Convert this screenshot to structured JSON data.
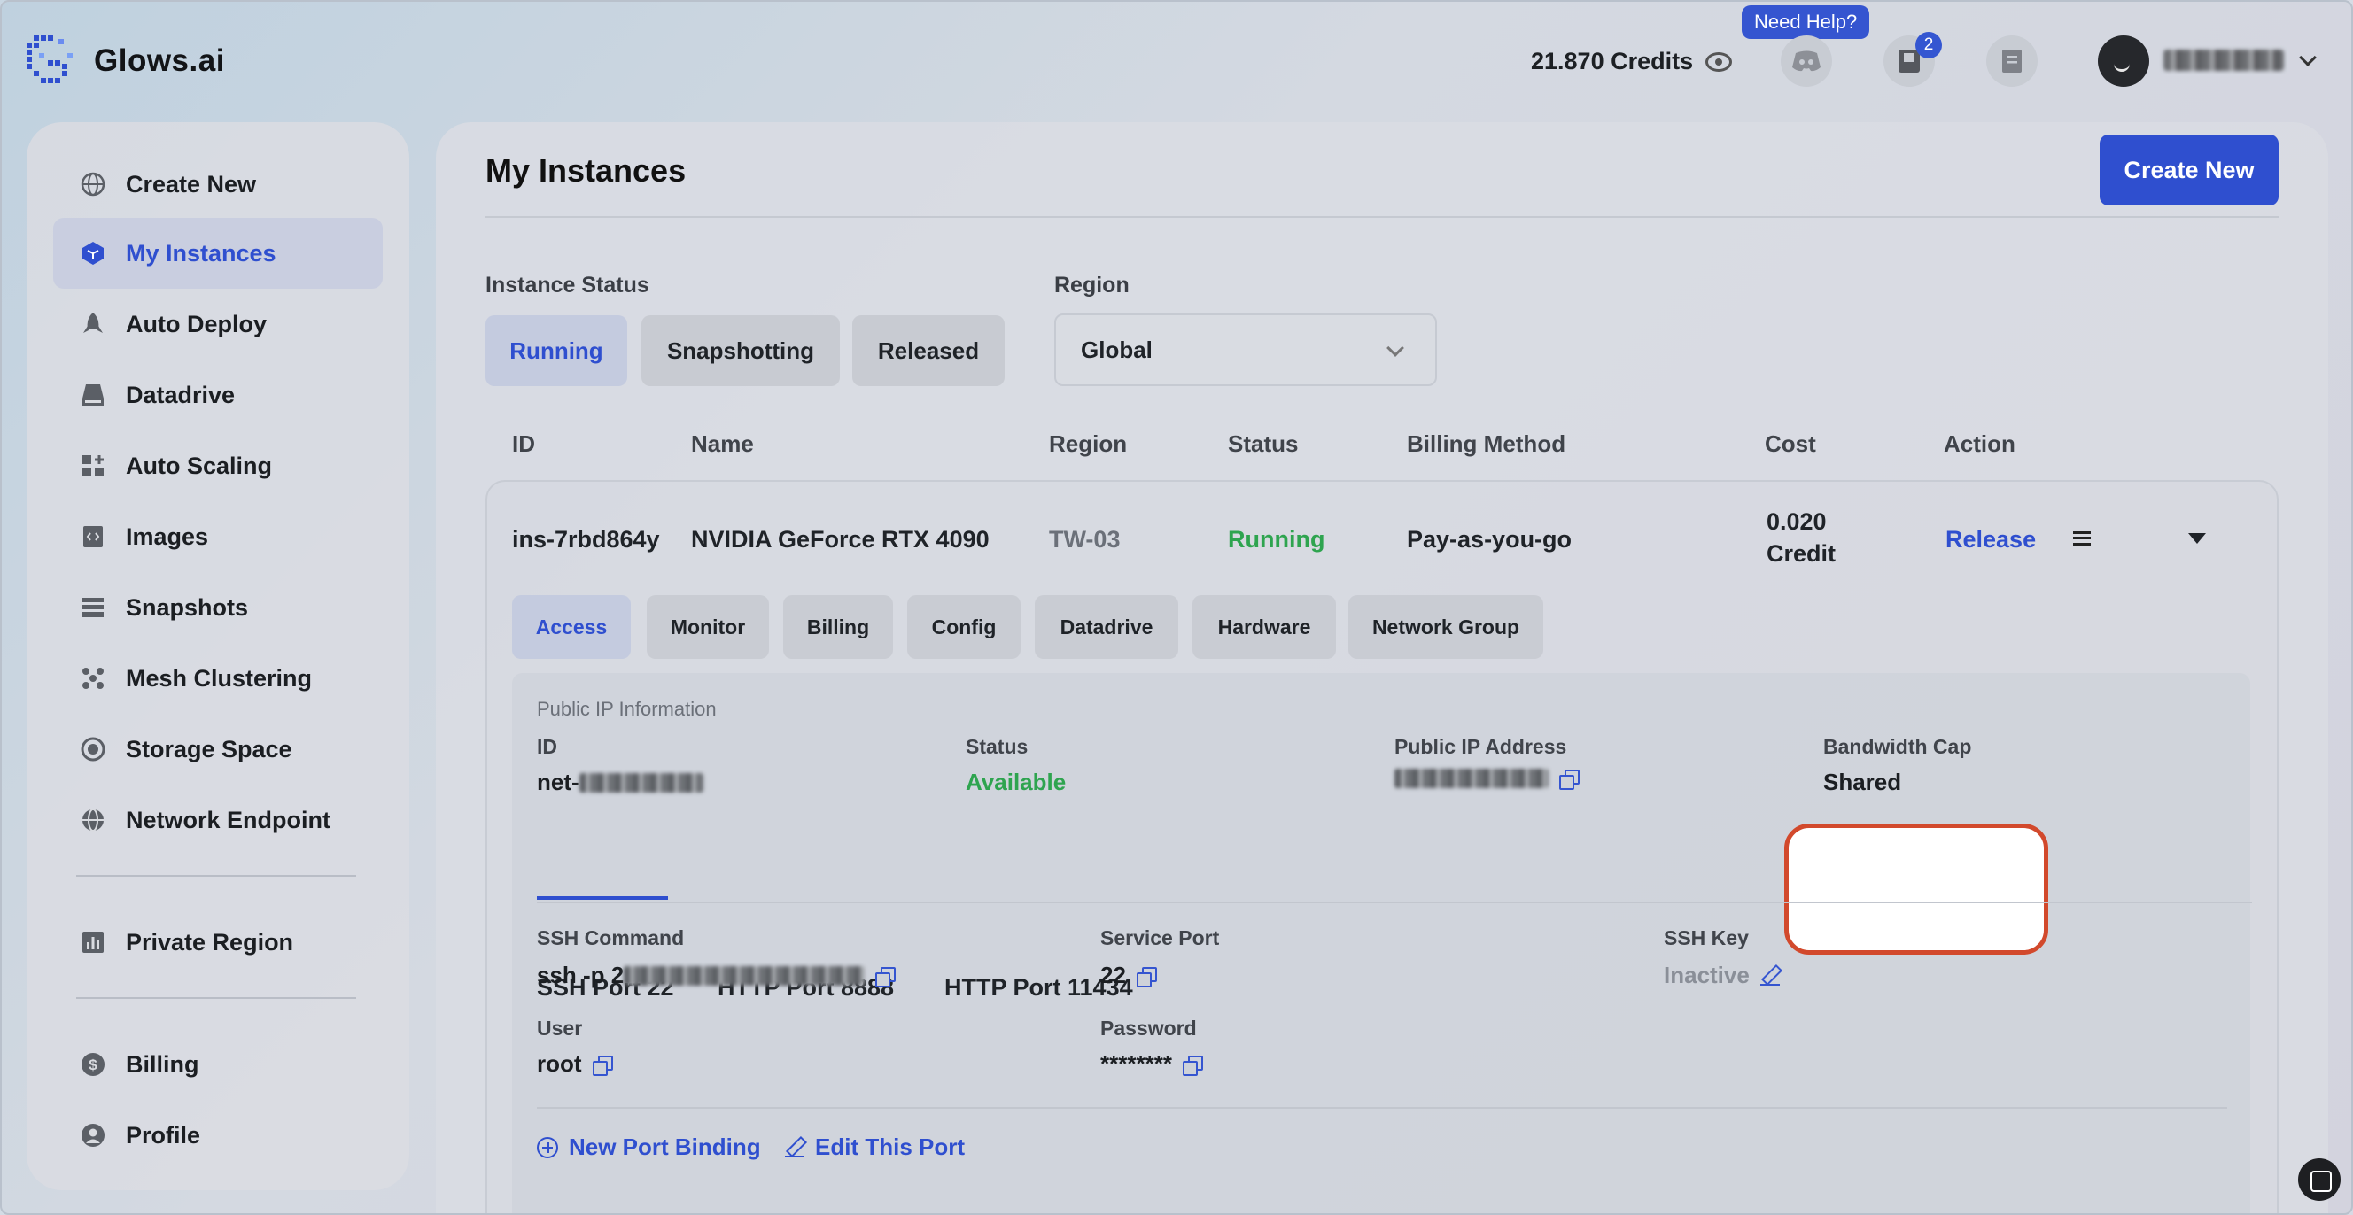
{
  "app": {
    "name": "Glows.ai"
  },
  "topbar": {
    "credits": "21.870 Credits",
    "help_label": "Need Help?",
    "notification_count": "2"
  },
  "sidebar": {
    "items": [
      {
        "label": "Create New",
        "icon": "globe-icon"
      },
      {
        "label": "My Instances",
        "icon": "cube-icon",
        "active": true
      },
      {
        "label": "Auto Deploy",
        "icon": "rocket-icon"
      },
      {
        "label": "Datadrive",
        "icon": "drive-icon"
      },
      {
        "label": "Auto Scaling",
        "icon": "grid-plus-icon"
      },
      {
        "label": "Images",
        "icon": "image-code-icon"
      },
      {
        "label": "Snapshots",
        "icon": "archive-icon"
      },
      {
        "label": "Mesh Clustering",
        "icon": "cluster-icon"
      },
      {
        "label": "Storage Space",
        "icon": "storage-icon"
      },
      {
        "label": "Network Endpoint",
        "icon": "network-icon"
      },
      {
        "label": "Private Region",
        "icon": "bar-chart-icon"
      },
      {
        "label": "Billing",
        "icon": "dollar-icon"
      },
      {
        "label": "Profile",
        "icon": "user-icon"
      }
    ]
  },
  "main": {
    "title": "My Instances",
    "create_button": "Create New",
    "status_label": "Instance Status",
    "status_options": [
      "Running",
      "Snapshotting",
      "Released"
    ],
    "region_label": "Region",
    "region_value": "Global",
    "table_headers": [
      "ID",
      "Name",
      "Region",
      "Status",
      "Billing Method",
      "Cost",
      "Action"
    ],
    "instance": {
      "id": "ins-7rbd864y",
      "name": "NVIDIA GeForce RTX 4090",
      "region": "TW-03",
      "status": "Running",
      "billing_method": "Pay-as-you-go",
      "cost_line1": "0.020",
      "cost_line2": "Credit",
      "action": "Release"
    },
    "detail_tabs": [
      "Access",
      "Monitor",
      "Billing",
      "Config",
      "Datadrive",
      "Hardware",
      "Network Group"
    ],
    "public_ip": {
      "section_title": "Public IP Information",
      "id_label": "ID",
      "id_prefix": "net-",
      "status_label": "Status",
      "status_value": "Available",
      "address_label": "Public IP Address",
      "bandwidth_label": "Bandwidth Cap",
      "bandwidth_value": "Shared"
    },
    "port_tabs": [
      "SSH Port 22",
      "HTTP Port 8888",
      "HTTP Port 11434"
    ],
    "ssh": {
      "command_label": "SSH Command",
      "command_prefix": "ssh -p 2",
      "service_port_label": "Service Port",
      "service_port_value": "22",
      "ssh_key_label": "SSH Key",
      "ssh_key_value": "Inactive",
      "user_label": "User",
      "user_value": "root",
      "password_label": "Password",
      "password_value": "********"
    },
    "actions": {
      "new_port": "New Port Binding",
      "edit_port": "Edit This Port"
    }
  },
  "colors": {
    "accent": "#2f4fcf",
    "running": "#2ea44f",
    "highlight_border": "#d2492c"
  }
}
